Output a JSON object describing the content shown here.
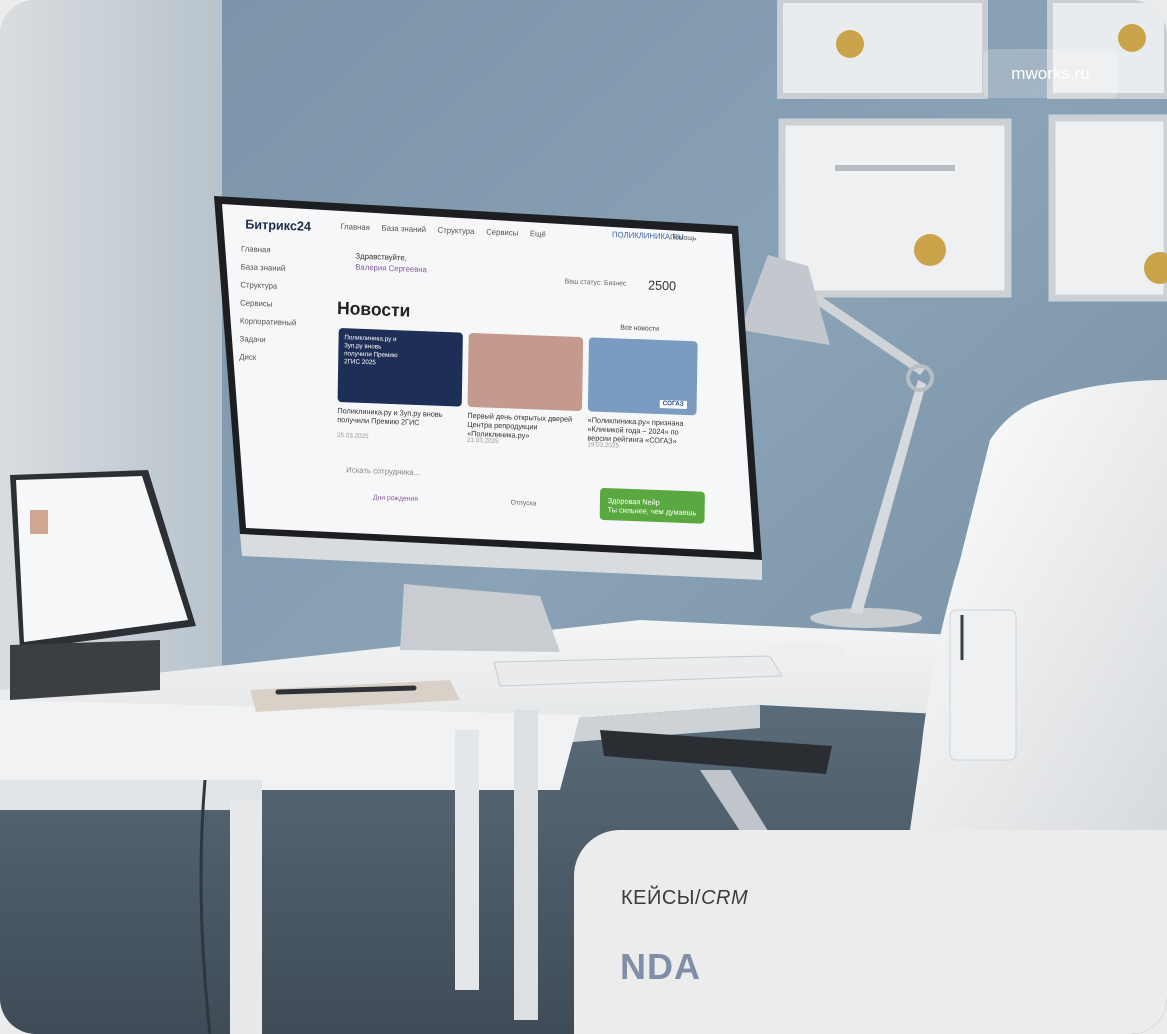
{
  "badge": {
    "site": "mworks.ru"
  },
  "caption": {
    "category": "КЕЙСЫ/",
    "subcategory": "CRM",
    "client": "NDA"
  },
  "screen": {
    "logo": "Битрикс24",
    "topnav": [
      "Главная",
      "База знаний",
      "Структура",
      "Сервисы",
      "Ещё"
    ],
    "org": "ПОЛИКЛИНИКА.RU",
    "help": "Помощь",
    "sidebar": [
      "Главная",
      "База знаний",
      "Структура",
      "Сервисы",
      "Корпоративный",
      "Задачи",
      "Диск"
    ],
    "greeting": "Здравствуйте,",
    "user_name": "Валерия Сергеевна",
    "awards": "Ваш статус: Бизнес",
    "points": "2500",
    "news_title": "Новости",
    "all_news": "Все новости",
    "tile1_text": "Поликлиника.ру и 3уп.ру вновь получили Премию 2ГИС 2025",
    "tile3_brand": "СОГАЗ",
    "news": [
      {
        "title": "Поликлиника.ру и 3уп.ру вновь получили Премию 2ГИС",
        "date": "25.03.2025"
      },
      {
        "title": "Первый день открытых дверей Центра репродукции «Поликлиника.ру»",
        "date": "21.03.2025"
      },
      {
        "title": "«Поликлиника.ру» признана «Клиникой года – 2024» по версии рейтинга «СОГАЗ»",
        "date": "19.03.2025"
      }
    ],
    "search_placeholder": "Искать сотрудника...",
    "tab_birthdays": "Дни рождения",
    "tab_vacations": "Отпуска",
    "health_widget": "Здоровая Neйр",
    "health_sub": "Ты сильнее, чем думаешь"
  }
}
